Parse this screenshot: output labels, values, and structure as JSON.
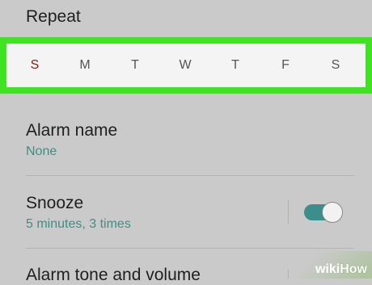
{
  "repeat": {
    "label": "Repeat",
    "days": [
      {
        "label": "S",
        "name": "sunday"
      },
      {
        "label": "M",
        "name": "monday"
      },
      {
        "label": "T",
        "name": "tuesday"
      },
      {
        "label": "W",
        "name": "wednesday"
      },
      {
        "label": "T",
        "name": "thursday"
      },
      {
        "label": "F",
        "name": "friday"
      },
      {
        "label": "S",
        "name": "saturday"
      }
    ]
  },
  "alarm_name": {
    "title": "Alarm name",
    "value": "None"
  },
  "snooze": {
    "title": "Snooze",
    "value": "5 minutes, 3 times",
    "enabled": true
  },
  "alarm_tone": {
    "title": "Alarm tone and volume"
  },
  "watermark": {
    "wiki": "wiki",
    "how": "How"
  },
  "colors": {
    "highlight": "#3fe321",
    "accent": "#3f8f84",
    "sunday": "#8b1a1a"
  }
}
